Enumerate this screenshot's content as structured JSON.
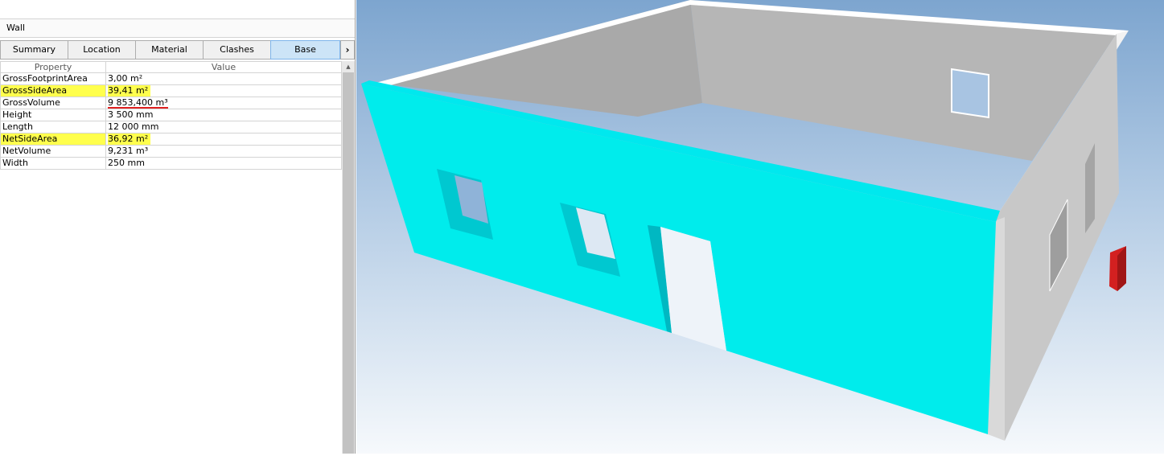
{
  "panel": {
    "title": "Wall",
    "tabs": [
      {
        "label": "Summary",
        "active": false
      },
      {
        "label": "Location",
        "active": false
      },
      {
        "label": "Material",
        "active": false
      },
      {
        "label": "Clashes",
        "active": false
      },
      {
        "label": "Base quantities",
        "active": true
      }
    ],
    "scroll_icon": "chevron-right-icon",
    "columns": [
      "Property",
      "Value"
    ],
    "rows": [
      {
        "property": "GrossFootprintArea",
        "value": "3,00 m²"
      },
      {
        "property": "GrossSideArea",
        "value": "39,41 m²",
        "highlight": true
      },
      {
        "property": "GrossVolume",
        "value": "9 853,400 m³",
        "underline": true
      },
      {
        "property": "Height",
        "value": "3 500 mm"
      },
      {
        "property": "Length",
        "value": "12 000 mm"
      },
      {
        "property": "NetSideArea",
        "value": "36,92 m²",
        "highlight": true
      },
      {
        "property": "NetVolume",
        "value": "9,231 m³"
      },
      {
        "property": "Width",
        "value": "250 mm"
      }
    ]
  },
  "colors": {
    "selected_wall": "#00ecec",
    "wall_face": "#b8b8b8",
    "highlight": "#ffff4d",
    "annotation": "#e02020"
  }
}
